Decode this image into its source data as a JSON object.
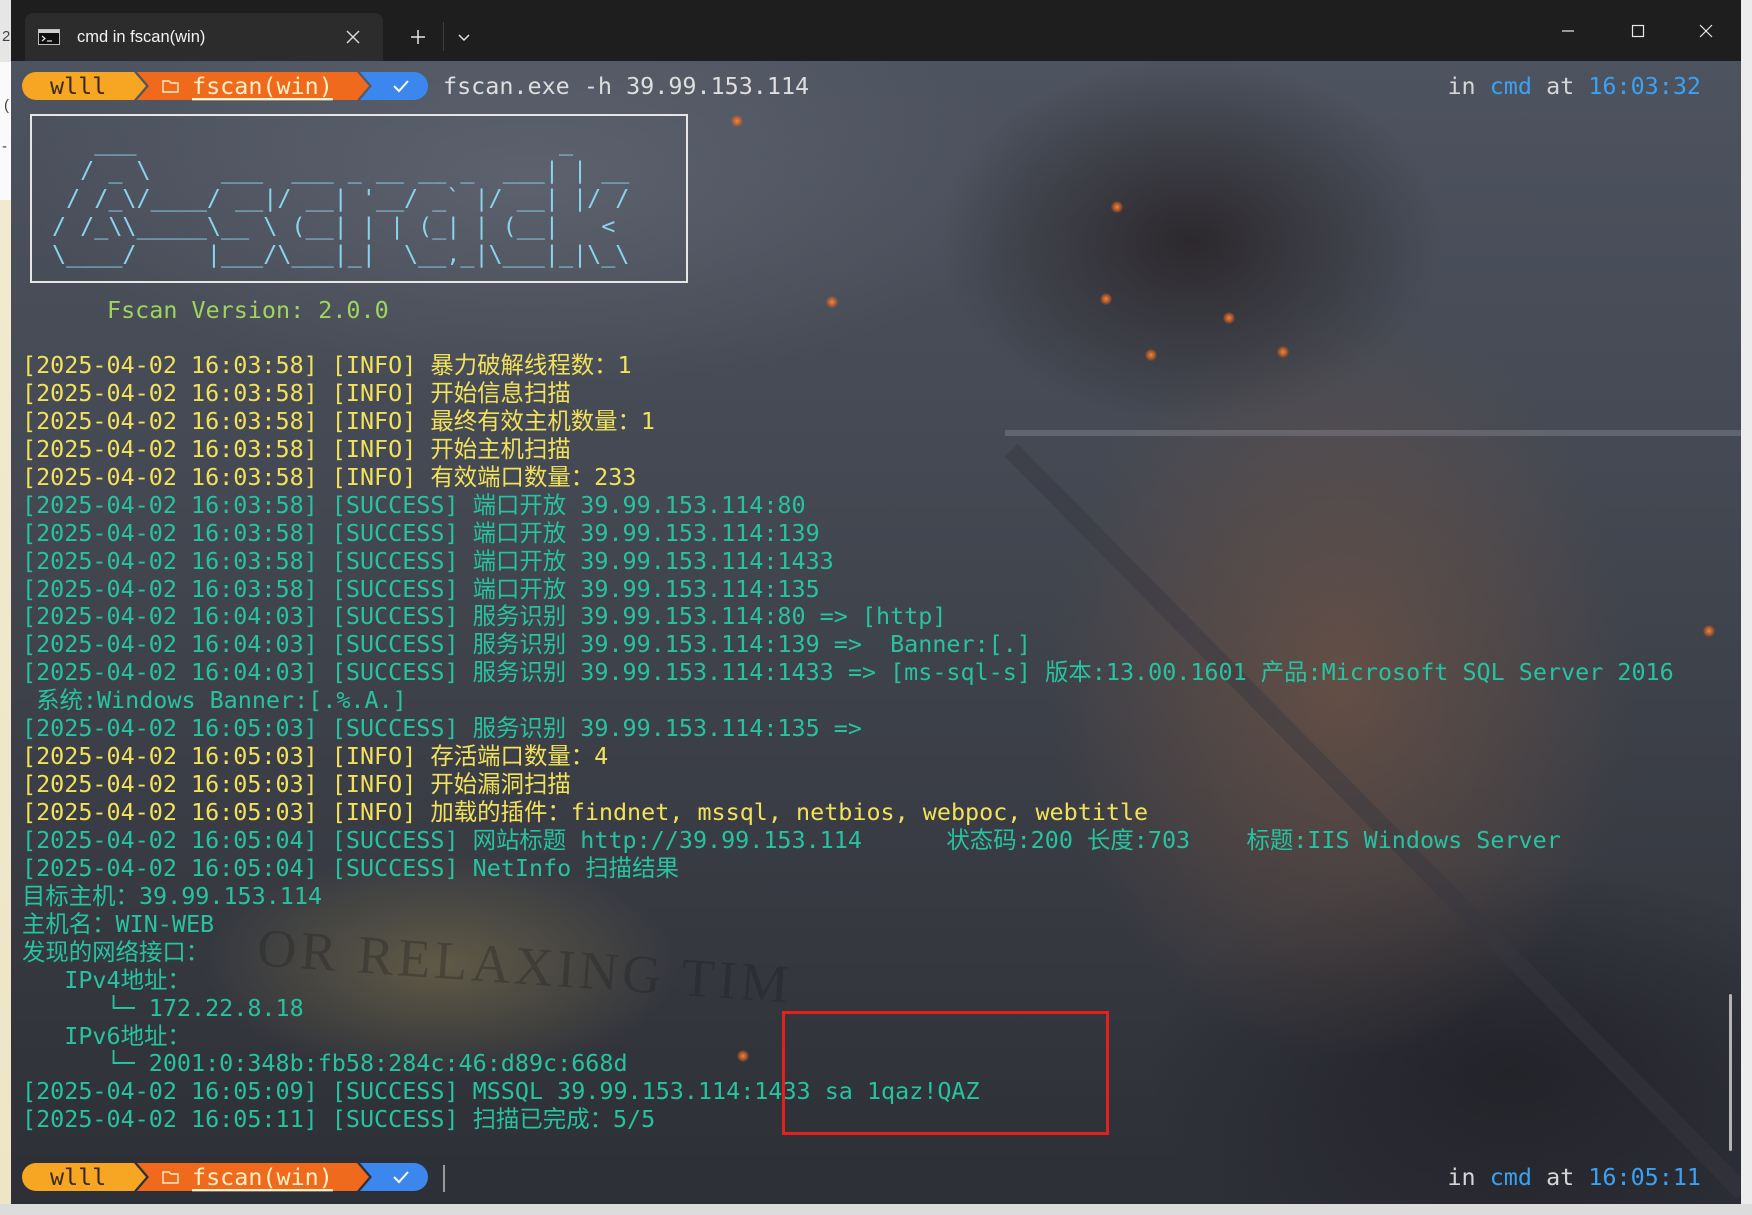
{
  "background_window": {
    "fragments": [
      "2",
      "(",
      "-"
    ]
  },
  "titlebar": {
    "tab_title": "cmd in fscan(win)"
  },
  "icons": {
    "tab": "terminal-icon",
    "tab_close": "close-icon",
    "new_tab": "plus-icon",
    "dropdown": "chevron-down-icon",
    "minimize": "minimize-icon",
    "maximize": "maximize-icon",
    "close": "close-icon",
    "prompt_dir": "folder-icon",
    "prompt_status": "check-icon"
  },
  "prompt_top": {
    "user": "wlll",
    "dir": "fscan(win)",
    "command": "fscan.exe -h 39.99.153.114",
    "in_label": "in",
    "shell": "cmd",
    "at_label": "at",
    "time": "16:03:32"
  },
  "banner": {
    "ascii": [
      "   ___                              _",
      "  / _ \\     ___  ___ _ __ __ _  ___| | __",
      " / /_\\/____/ __|/ __| '__/ _` |/ __| |/ /",
      "/ /_\\\\_____\\__ \\ (__| | | (_| | (__|   <",
      "\\____/     |___/\\___|_|  \\__,_|\\___|_|\\_\\"
    ],
    "version": "Fscan Version: 2.0.0"
  },
  "log": [
    "[2025-04-02 16:03:58] [INFO] 暴力破解线程数：1",
    "[2025-04-02 16:03:58] [INFO] 开始信息扫描",
    "[2025-04-02 16:03:58] [INFO] 最终有效主机数量：1",
    "[2025-04-02 16:03:58] [INFO] 开始主机扫描",
    "[2025-04-02 16:03:58] [INFO] 有效端口数量：233",
    "[2025-04-02 16:03:58] [SUCCESS] 端口开放 39.99.153.114:80",
    "[2025-04-02 16:03:58] [SUCCESS] 端口开放 39.99.153.114:139",
    "[2025-04-02 16:03:58] [SUCCESS] 端口开放 39.99.153.114:1433",
    "[2025-04-02 16:03:58] [SUCCESS] 端口开放 39.99.153.114:135",
    "[2025-04-02 16:04:03] [SUCCESS] 服务识别 39.99.153.114:80 => [http]",
    "[2025-04-02 16:04:03] [SUCCESS] 服务识别 39.99.153.114:139 =>  Banner:[.]",
    "[2025-04-02 16:04:03] [SUCCESS] 服务识别 39.99.153.114:1433 => [ms-sql-s] 版本:13.00.1601 产品:Microsoft SQL Server 2016",
    " 系统:Windows Banner:[.%.A.]",
    "[2025-04-02 16:05:03] [SUCCESS] 服务识别 39.99.153.114:135 =>",
    "[2025-04-02 16:05:03] [INFO] 存活端口数量：4",
    "[2025-04-02 16:05:03] [INFO] 开始漏洞扫描",
    "[2025-04-02 16:05:03] [INFO] 加载的插件：findnet, mssql, netbios, webpoc, webtitle",
    "[2025-04-02 16:05:04] [SUCCESS] 网站标题 http://39.99.153.114      状态码:200 长度:703    标题:IIS Windows Server",
    "[2025-04-02 16:05:04] [SUCCESS] NetInfo 扫描结果",
    "目标主机：39.99.153.114",
    "主机名：WIN-WEB",
    "发现的网络接口：",
    "   IPv4地址：",
    "      └─ 172.22.8.18",
    "   IPv6地址：",
    "      └─ 2001:0:348b:fb58:284c:46:d89c:668d",
    "[2025-04-02 16:05:09] [SUCCESS] MSSQL 39.99.153.114:1433 sa 1qaz!QAZ",
    "[2025-04-02 16:05:11] [SUCCESS] 扫描已完成：5/5"
  ],
  "prompt_bottom": {
    "user": "wlll",
    "dir": "fscan(win)",
    "in_label": "in",
    "shell": "cmd",
    "at_label": "at",
    "time": "16:05:11"
  },
  "background_art": {
    "sign_text": "OR RELAXING TIM"
  },
  "colors": {
    "info": "#f1e15b",
    "success": "#27c3a1",
    "version": "#9fd45e",
    "banner": "#8ad3ec",
    "command": "#dedede",
    "prompt_user_bg": "#f6a623",
    "prompt_dir_bg": "#ef6a1c",
    "prompt_status_bg": "#3b87ee",
    "accent_blue": "#3aa2f2",
    "highlight_box": "#e3201b"
  }
}
